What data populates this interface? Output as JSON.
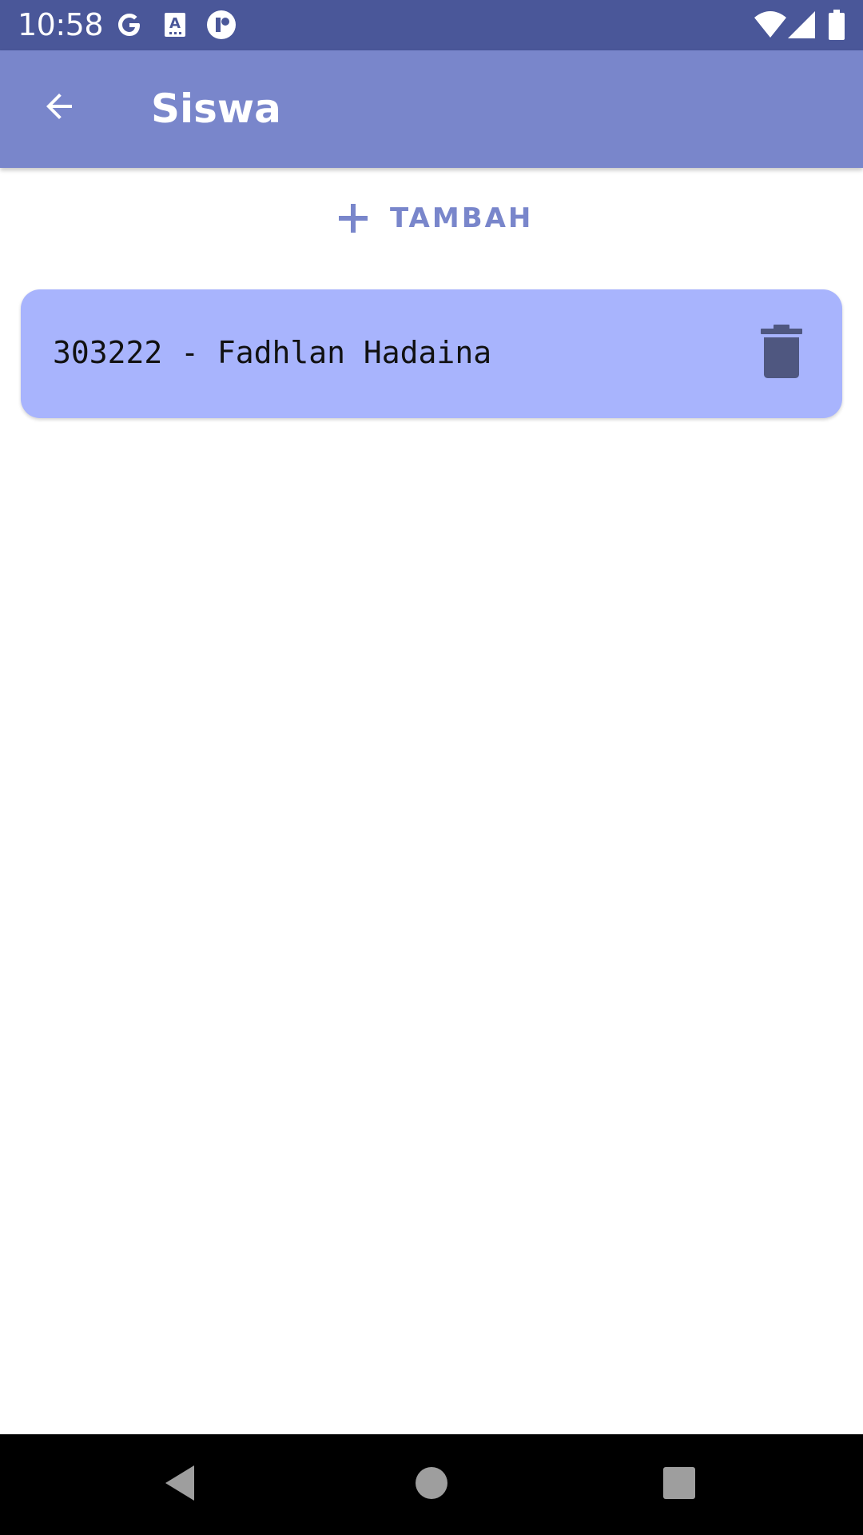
{
  "status_bar": {
    "time": "10:58",
    "icons": [
      "google-icon",
      "keyboard-a-icon",
      "app-circle-icon",
      "wifi-icon",
      "signal-icon",
      "battery-icon"
    ]
  },
  "app_bar": {
    "title": "Siswa",
    "back_icon": "arrow-back-icon"
  },
  "add_button": {
    "label": "TAMBAH",
    "icon": "plus-icon"
  },
  "list": {
    "items": [
      {
        "text": "303222 - Fadhlan Hadaina",
        "delete_icon": "trash-icon"
      }
    ]
  },
  "nav_bar": {
    "buttons": [
      "back-triangle-icon",
      "home-circle-icon",
      "recents-square-icon"
    ]
  },
  "colors": {
    "status_bar": "#4a5799",
    "app_bar": "#7986cb",
    "accent": "#7986cb",
    "card": "#a8b4fd",
    "delete_icon": "#4f5780"
  }
}
